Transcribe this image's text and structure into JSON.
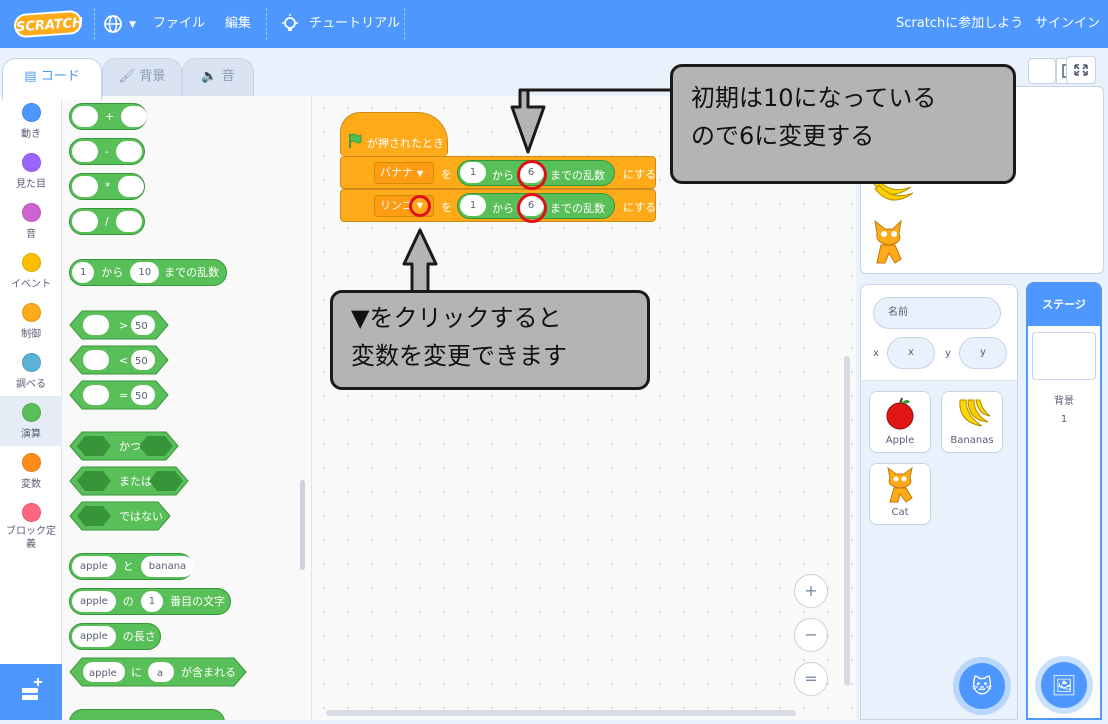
{
  "menubar": {
    "logo": "SCRATCH",
    "file": "ファイル",
    "edit": "編集",
    "tutorials": "チュートリアル",
    "join": "Scratchに参加しよう",
    "signin": "サインイン"
  },
  "tabs": {
    "code": "コード",
    "costumes": "背景",
    "sounds": "音"
  },
  "categories": [
    {
      "label": "動き",
      "color": "#4c97ff"
    },
    {
      "label": "見た目",
      "color": "#9966ff"
    },
    {
      "label": "音",
      "color": "#cf63cf"
    },
    {
      "label": "イベント",
      "color": "#ffbf00"
    },
    {
      "label": "制御",
      "color": "#ffab19"
    },
    {
      "label": "調べる",
      "color": "#5cb1d6"
    },
    {
      "label": "演算",
      "color": "#59c059"
    },
    {
      "label": "変数",
      "color": "#ff8c1a"
    },
    {
      "label": "ブロック定義",
      "color": "#ff6680"
    }
  ],
  "palette": {
    "ops": [
      "+",
      "-",
      "*",
      "/"
    ],
    "random": {
      "from": "1",
      "word1": "から",
      "to": "10",
      "word2": "までの乱数"
    },
    "compare": [
      {
        "op": ">",
        "val": "50"
      },
      {
        "op": "<",
        "val": "50"
      },
      {
        "op": "=",
        "val": "50"
      }
    ],
    "and": "かつ",
    "or": "または",
    "not": "ではない",
    "join": {
      "a": "apple",
      "word": "と",
      "b": "banana"
    },
    "letter": {
      "a": "apple",
      "word1": "の",
      "n": "1",
      "word2": "番目の文字"
    },
    "length": {
      "a": "apple",
      "word": "の長さ"
    },
    "contains": {
      "a": "apple",
      "word1": "に",
      "b": "a",
      "word2": "が含まれる"
    }
  },
  "script": {
    "hat": "が押されたとき",
    "row1": {
      "var": "バナナ",
      "wo": "を",
      "from": "1",
      "kara": "から",
      "to": "6",
      "made": "までの乱数",
      "suru": "にする"
    },
    "row2": {
      "var": "リンゴ",
      "wo": "を",
      "from": "1",
      "kara": "から",
      "to": "6",
      "made": "までの乱数",
      "suru": "にする"
    }
  },
  "zoom": {
    "in": "+",
    "out": "−",
    "reset": "="
  },
  "callouts": {
    "top_line1": "初期は10になっている",
    "top_line2": "ので6に変更する",
    "bottom_line1": "▼をクリックすると",
    "bottom_line2": "変数を変更できます"
  },
  "sprite_info": {
    "name_placeholder": "名前",
    "x_label": "x",
    "x_placeholder": "x",
    "y_label": "y",
    "y_placeholder": "y"
  },
  "sprites": [
    {
      "name": "Apple"
    },
    {
      "name": "Bananas"
    },
    {
      "name": "Cat"
    }
  ],
  "stage_panel": {
    "title": "ステージ",
    "backdrops_label": "背景",
    "backdrops_count": "1"
  }
}
